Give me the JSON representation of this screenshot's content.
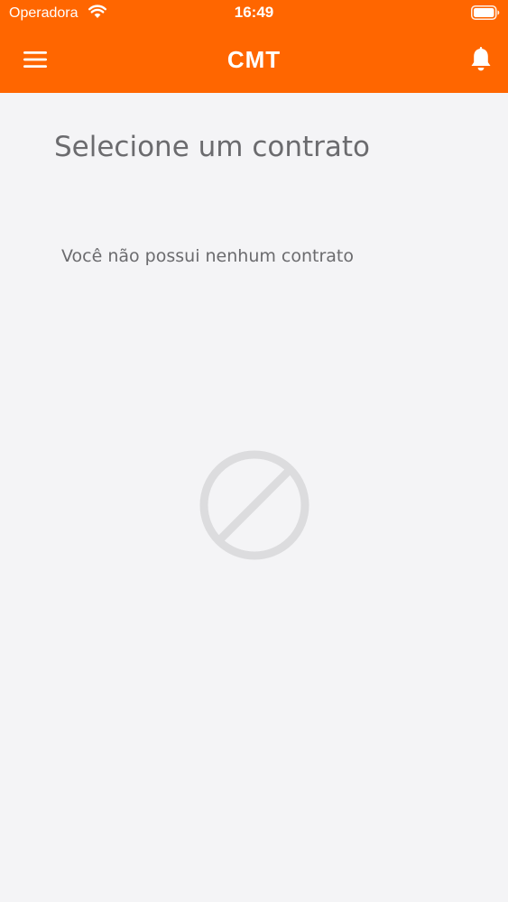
{
  "status_bar": {
    "carrier": "Operadora",
    "time": "16:49",
    "wifi_icon": "wifi-icon",
    "battery_icon": "battery-icon"
  },
  "nav_bar": {
    "title": "CMT",
    "menu_icon": "hamburger-menu-icon",
    "notification_icon": "bell-icon"
  },
  "main": {
    "title": "Selecione um contrato",
    "empty_message": "Você não possui nenhum contrato",
    "empty_icon": "prohibited-icon"
  },
  "colors": {
    "brand": "#ff6600",
    "background": "#f4f4f6",
    "text": "#6b6b6e",
    "icon_muted": "#dcdcde"
  }
}
